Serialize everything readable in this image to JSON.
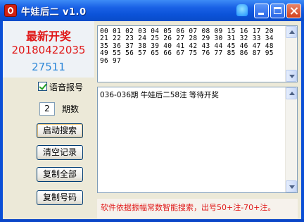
{
  "window": {
    "title": "牛娃后二 v1.0"
  },
  "summary": {
    "headline": "最新开奖",
    "period": "20180422035",
    "count": "27511"
  },
  "numbers_box": {
    "text": "00 01 02 03 04 05 06 07 08 09 15 16 17 20 21 22 23 24 25 26 27 28 29 30 31 32 33 34 35 36 37 38 39 40 41 42 43 44 45 46 47 48 49 55 56 57 65 66 67 75 76 77 85 86 87 95 96 97"
  },
  "log_box": {
    "text": "036-036期 牛娃后二58注 等待开奖"
  },
  "controls": {
    "voice_checkbox_label": "语音报号",
    "voice_checked": true,
    "periods_value": "2",
    "periods_label": "期数",
    "start_search": "启动搜索",
    "clear_records": "清空记录",
    "copy_all": "复制全部",
    "copy_numbers": "复制号码"
  },
  "notice": "软件依据振幅常数智能搜索，出号50+注-70+注。",
  "colors": {
    "title_bar": "#0b52d8",
    "accent_red": "#e01818",
    "accent_blue": "#2f88d8",
    "face": "#ece9d8"
  },
  "icons": {
    "app": "app-logo-icon",
    "help": "shirt-icon",
    "minimize": "minimize-icon",
    "maximize": "maximize-icon",
    "close": "close-icon"
  }
}
